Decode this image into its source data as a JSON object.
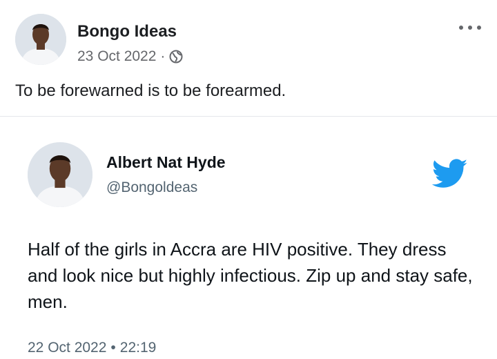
{
  "post": {
    "author": "Bongo Ideas",
    "date": "23 Oct 2022",
    "separator": "·",
    "audience_icon": "globe-icon",
    "text": "To be forewarned is to be forearmed.",
    "menu_icon": "more-options-icon"
  },
  "tweet": {
    "name": "Albert Nat Hyde",
    "handle": "@Bongoldeas",
    "text": "Half of the girls in Accra are HIV positive. They dress and look nice but highly infectious. Zip up and stay safe, men.",
    "date": "22 Oct 2022",
    "separator": "•",
    "time": "22:19",
    "brand_icon": "twitter-bird-icon",
    "brand_color": "#1d9bf0"
  }
}
